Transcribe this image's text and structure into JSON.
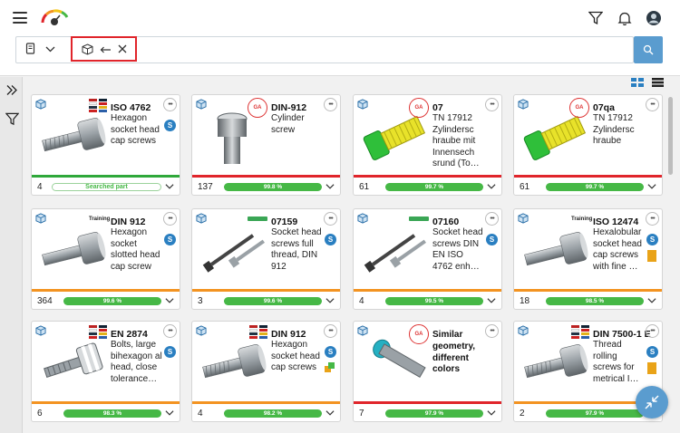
{
  "colors": {
    "accent": "#5a9ccf",
    "highlight_red": "#e0252b",
    "bar_green": "#46b846",
    "stripe_green": "#2fa83a",
    "stripe_red": "#e0252b",
    "stripe_orange": "#f39321"
  },
  "cards": [
    {
      "title": "ISO 4762",
      "desc": "Hexagon socket head cap screws",
      "count": "4",
      "bar": "Searched part",
      "badge": "flags",
      "stripe": "green"
    },
    {
      "title": "DIN-912",
      "desc": "Cylinder screw",
      "count": "137",
      "bar": "99.8 %",
      "badge": "stamp",
      "stripe": "red"
    },
    {
      "title": "07",
      "desc": "TN 17912 Zylindersc hraube mit Innensech srund (To…",
      "count": "61",
      "bar": "99.7 %",
      "badge": "stamp",
      "stripe": "red"
    },
    {
      "title": "07qa",
      "desc": "TN 17912 Zylindersc hraube",
      "count": "61",
      "bar": "99.7 %",
      "badge": "stamp",
      "stripe": "red"
    },
    {
      "title": "DIN 912",
      "desc": "Hexagon socket slotted head cap screw",
      "count": "364",
      "bar": "99.6 %",
      "badge": "Training",
      "stripe": "orange"
    },
    {
      "title": "07159",
      "desc": "Socket head screws full thread, DIN 912",
      "count": "3",
      "bar": "99.6 %",
      "badge": "green",
      "stripe": "orange"
    },
    {
      "title": "07160",
      "desc": "Socket head screws DIN EN ISO 4762 enh…",
      "count": "4",
      "bar": "99.5 %",
      "badge": "green",
      "stripe": "orange"
    },
    {
      "title": "ISO 12474",
      "desc": "Hexalobular socket head cap screws with fine …",
      "count": "18",
      "bar": "98.5 %",
      "badge": "Training",
      "stripe": "orange"
    },
    {
      "title": "EN 2874",
      "desc": "Bolts, large bihexagon al head, close tolerance…",
      "count": "6",
      "bar": "98.3 %",
      "badge": "flags",
      "stripe": "orange"
    },
    {
      "title": "DIN 912",
      "desc": "Hexagon socket head cap screws",
      "count": "4",
      "bar": "98.2 %",
      "badge": "flags",
      "stripe": "orange"
    },
    {
      "title": "",
      "desc": "Similar geometry, different colors",
      "count": "7",
      "bar": "97.9 %",
      "badge": "stamp",
      "stripe": "red"
    },
    {
      "title": "DIN 7500-1 E",
      "desc": "Thread rolling screws for metrical I…",
      "count": "2",
      "bar": "97.9 %",
      "badge": "flags",
      "stripe": "orange"
    }
  ],
  "badge_text": {
    "stamp": "GA",
    "training": "Training",
    "s": "S"
  },
  "icons": [
    "menu-icon",
    "logo-gauge-icon",
    "filter-icon",
    "bell-icon",
    "user-avatar-icon",
    "catalog-icon",
    "chevron-down-icon",
    "cube-icon",
    "arrow-left-icon",
    "close-icon",
    "search-icon",
    "expand-icon",
    "grid-view-icon",
    "list-view-icon",
    "more-icon",
    "compare-icon"
  ]
}
